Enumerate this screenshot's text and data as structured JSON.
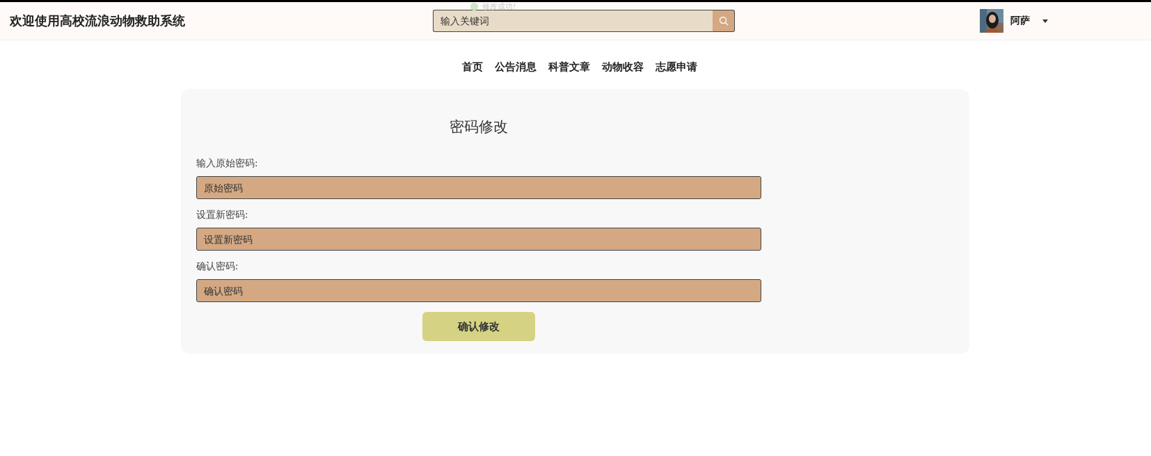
{
  "header": {
    "title": "欢迎使用高校流浪动物救助系统",
    "search": {
      "placeholder": "输入关键词"
    },
    "toast": {
      "text": "修改成功!"
    },
    "user": {
      "name": "阿萨"
    }
  },
  "nav": {
    "items": [
      {
        "label": "首页"
      },
      {
        "label": "公告消息"
      },
      {
        "label": "科普文章"
      },
      {
        "label": "动物收容"
      },
      {
        "label": "志愿申请"
      }
    ]
  },
  "form": {
    "title": "密码修改",
    "fields": [
      {
        "label": "输入原始密码:",
        "placeholder": "原始密码"
      },
      {
        "label": "设置新密码:",
        "placeholder": "设置新密码"
      },
      {
        "label": "确认密码:",
        "placeholder": "确认密码"
      }
    ],
    "submit": "确认修改"
  }
}
